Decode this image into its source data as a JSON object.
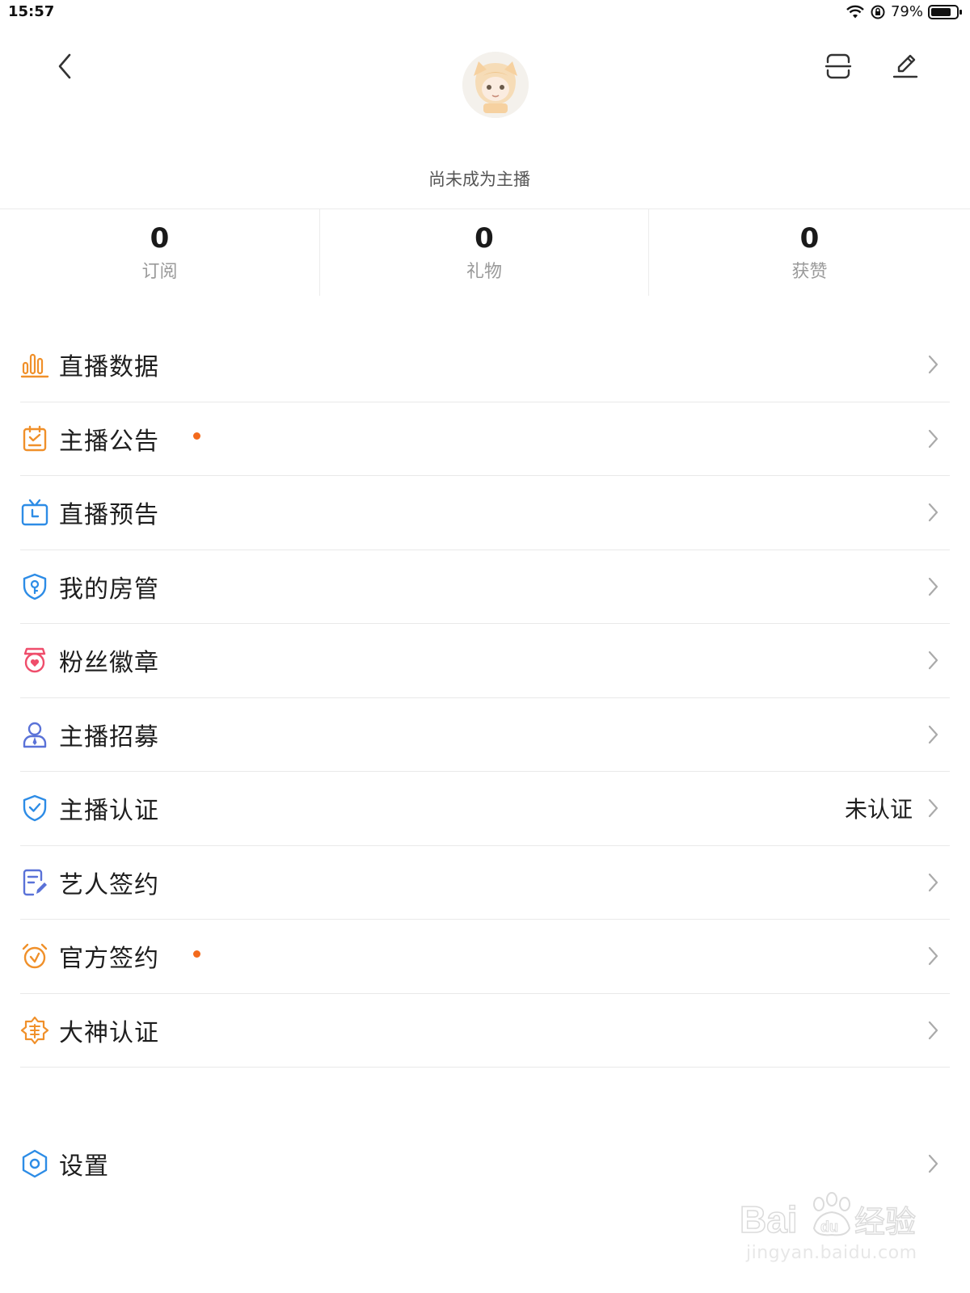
{
  "status_bar": {
    "time": "15:57",
    "battery": "79%",
    "battery_level": 0.79
  },
  "header": {
    "subtitle": "尚未成为主播"
  },
  "stats": [
    {
      "value": "0",
      "label": "订阅"
    },
    {
      "value": "0",
      "label": "礼物"
    },
    {
      "value": "0",
      "label": "获赞"
    }
  ],
  "menu": [
    {
      "label": "直播数据",
      "icon": "bar-chart-icon",
      "color": "#f0902a",
      "dot": false,
      "value": ""
    },
    {
      "label": "主播公告",
      "icon": "notice-board-icon",
      "color": "#f0902a",
      "dot": true,
      "value": ""
    },
    {
      "label": "直播预告",
      "icon": "tv-clock-icon",
      "color": "#2d8ce6",
      "dot": false,
      "value": ""
    },
    {
      "label": "我的房管",
      "icon": "shield-key-icon",
      "color": "#2d8ce6",
      "dot": false,
      "value": ""
    },
    {
      "label": "粉丝徽章",
      "icon": "heart-badge-icon",
      "color": "#ef4d6b",
      "dot": false,
      "value": ""
    },
    {
      "label": "主播招募",
      "icon": "person-tie-icon",
      "color": "#5a72d8",
      "dot": false,
      "value": ""
    },
    {
      "label": "主播认证",
      "icon": "shield-check-icon",
      "color": "#2d8ce6",
      "dot": false,
      "value": "未认证"
    },
    {
      "label": "艺人签约",
      "icon": "contract-pen-icon",
      "color": "#5a72d8",
      "dot": false,
      "value": ""
    },
    {
      "label": "官方签约",
      "icon": "alarm-check-icon",
      "color": "#f0902a",
      "dot": true,
      "value": ""
    },
    {
      "label": "大神认证",
      "icon": "god-badge-icon",
      "color": "#f0902a",
      "dot": false,
      "value": ""
    }
  ],
  "settings": {
    "label": "设置",
    "icon": "hexagon-settings-icon",
    "color": "#2d8ce6"
  },
  "watermark": {
    "text": "jingyan.baidu.com",
    "logo": "Bai du 经验"
  },
  "colors": {
    "accent_dot": "#f36a1c",
    "divider": "#e9e9e9"
  }
}
